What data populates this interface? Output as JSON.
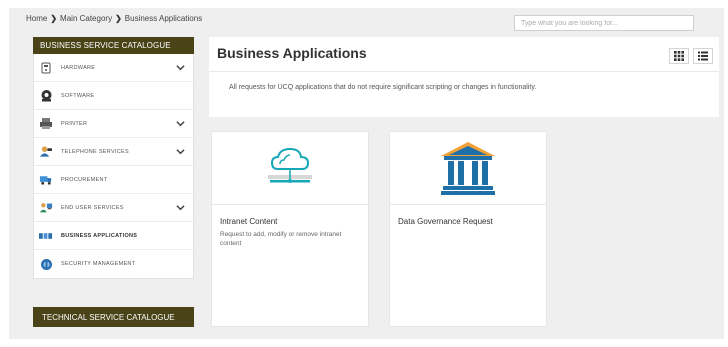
{
  "breadcrumb": {
    "home": "Home",
    "category": "Main Category",
    "current": "Business Applications"
  },
  "search": {
    "placeholder": "Type what you are looking for..."
  },
  "sidebar": {
    "business_header": "BUSINESS SERVICE CATALOGUE",
    "technical_header": "TECHNICAL SERVICE CATALOGUE",
    "items": [
      {
        "label": "HARDWARE",
        "icon": "hardware-icon",
        "expandable": true
      },
      {
        "label": "SOFTWARE",
        "icon": "software-icon",
        "expandable": false
      },
      {
        "label": "PRINTER",
        "icon": "printer-icon",
        "expandable": true
      },
      {
        "label": "TELEPHONE SERVICES",
        "icon": "telephone-icon",
        "expandable": true
      },
      {
        "label": "PROCUREMENT",
        "icon": "procurement-icon",
        "expandable": false
      },
      {
        "label": "END USER SERVICES",
        "icon": "end-user-icon",
        "expandable": true
      },
      {
        "label": "BUSINESS APPLICATIONS",
        "icon": "business-apps-icon",
        "expandable": false,
        "active": true
      },
      {
        "label": "SECURITY MANAGEMENT",
        "icon": "security-icon",
        "expandable": false
      }
    ]
  },
  "main": {
    "title": "Business Applications",
    "description": "All requests for UCQ applications that do not require significant scripting or changes in functionality.",
    "view_buttons": [
      "grid-view-icon",
      "list-view-icon"
    ]
  },
  "cards": [
    {
      "title": "Intranet Content",
      "description": "Request to add, modify or remove intranet content",
      "icon": "cloud-computer-icon"
    },
    {
      "title": "Data Governance Request",
      "description": "",
      "icon": "institution-building-icon"
    }
  ],
  "colors": {
    "header_bg": "#4a4318",
    "page_bg": "#efefef",
    "cloud_teal": "#17a8b8",
    "building_blue": "#1f6fa8",
    "roof_orange": "#f0a23c"
  }
}
